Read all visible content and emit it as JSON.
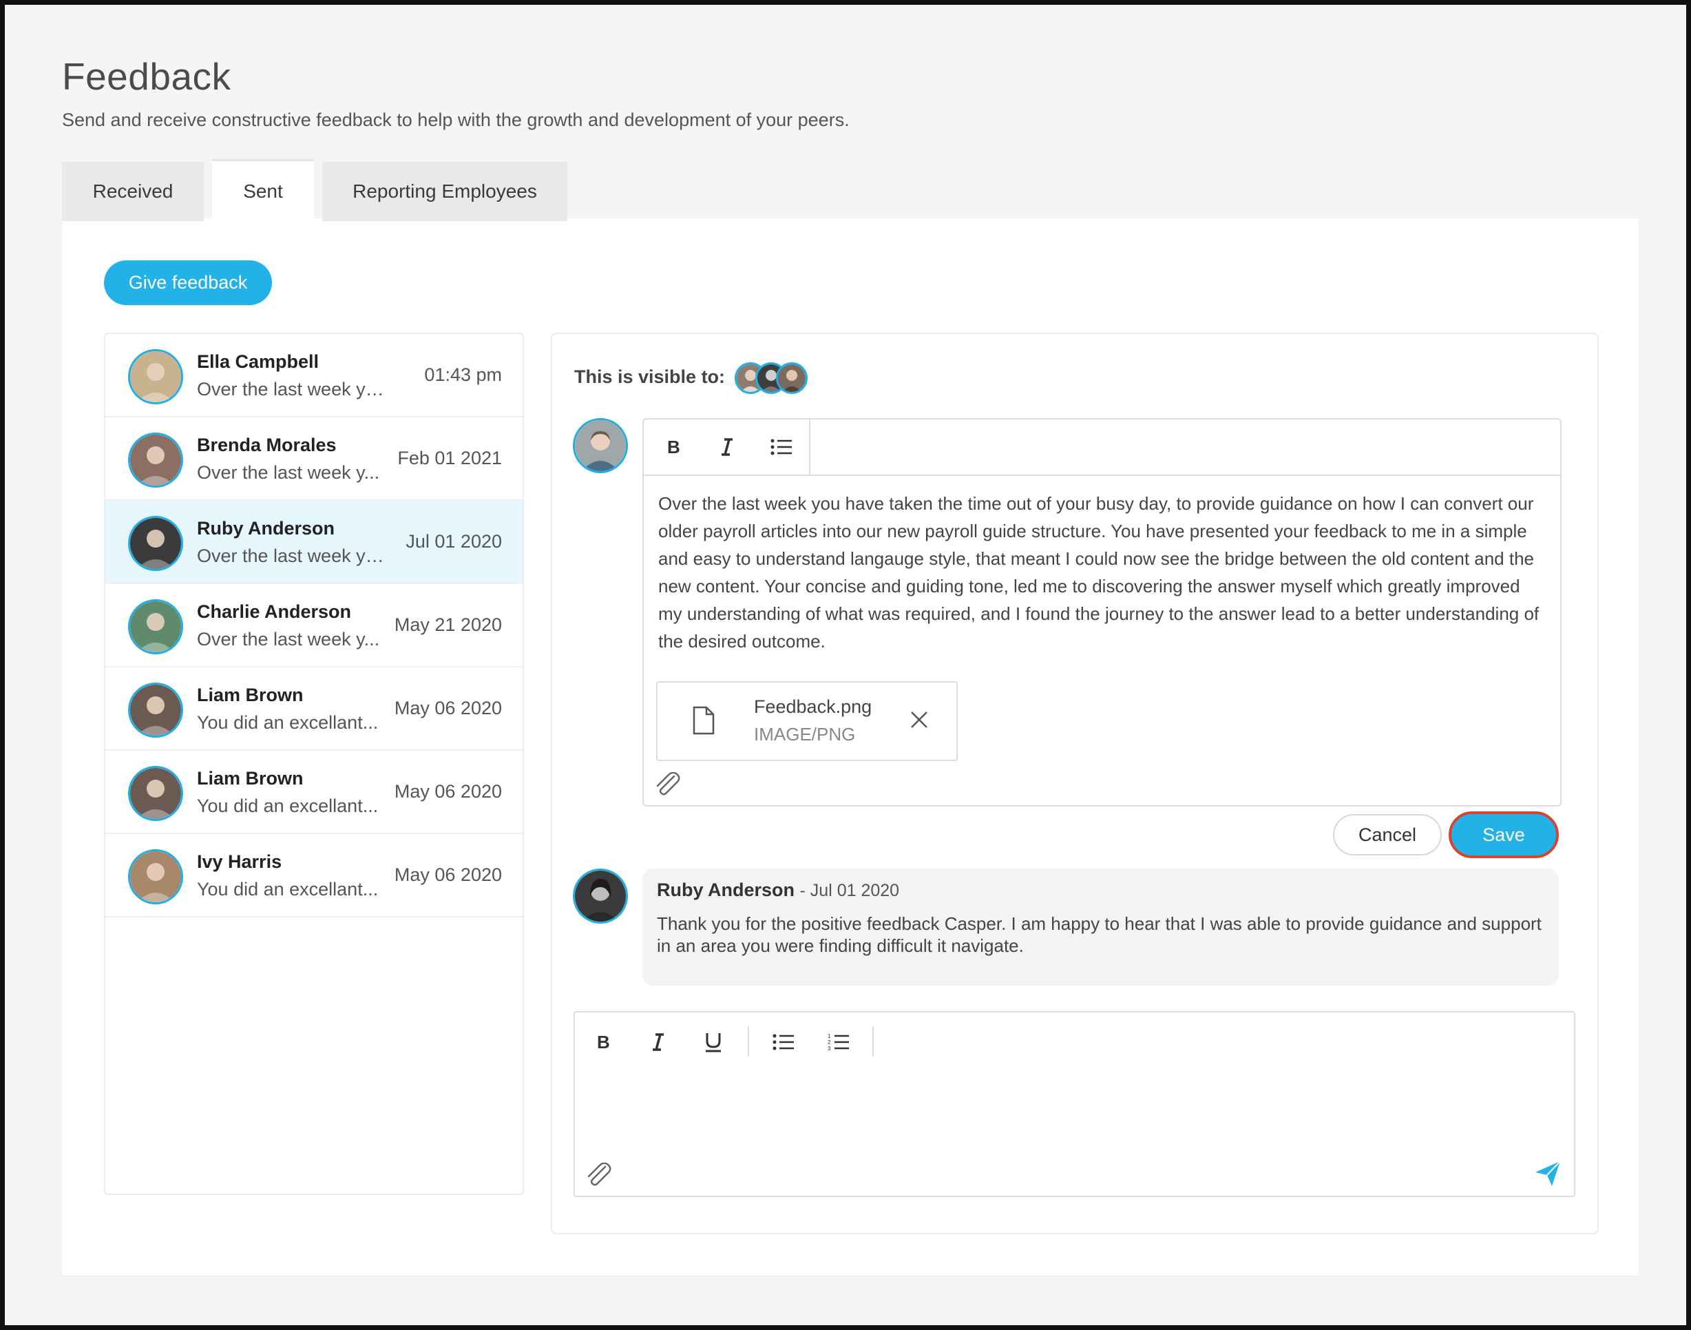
{
  "page": {
    "title": "Feedback",
    "subtitle": "Send and receive constructive feedback to help with the growth and development of your peers."
  },
  "tabs": [
    {
      "label": "Received",
      "active": false
    },
    {
      "label": "Sent",
      "active": true
    },
    {
      "label": "Reporting Employees",
      "active": false
    }
  ],
  "give_feedback_label": "Give feedback",
  "feedback_list": [
    {
      "name": "Ella Campbell",
      "preview": "Over the last week you ...",
      "date": "01:43 pm",
      "avatar_color": "#c9b28e",
      "selected": false
    },
    {
      "name": "Brenda Morales",
      "preview": "Over the last week y...",
      "date": "Feb 01 2021",
      "avatar_color": "#8a6f62",
      "selected": false
    },
    {
      "name": "Ruby Anderson",
      "preview": "Over the last week yo...",
      "date": "Jul 01 2020",
      "avatar_color": "#3b3b3b",
      "selected": true
    },
    {
      "name": "Charlie Anderson",
      "preview": "Over the last week y...",
      "date": "May 21 2020",
      "avatar_color": "#5f8a6b",
      "selected": false
    },
    {
      "name": "Liam Brown",
      "preview": "You did an excellant...",
      "date": "May 06 2020",
      "avatar_color": "#6b5a52",
      "selected": false
    },
    {
      "name": "Liam Brown",
      "preview": "You did an excellant...",
      "date": "May 06 2020",
      "avatar_color": "#6b5a52",
      "selected": false
    },
    {
      "name": "Ivy Harris",
      "preview": "You did an excellant...",
      "date": "May 06 2020",
      "avatar_color": "#a8876b",
      "selected": false
    }
  ],
  "detail": {
    "visible_label": "This is visible to:",
    "visible_avatars": [
      "#8d7b6b",
      "#3d3d3d",
      "#7a6b5e"
    ],
    "author_avatar_color": "#9fa7a8",
    "editor_toolbar": [
      "bold-icon",
      "italic-icon",
      "bullet-list-icon"
    ],
    "feedback_text": "Over the last week you have taken the time out of your busy day, to provide guidance on how I can convert our older payroll articles into our new payroll guide structure. You have presented your feedback to me in a simple and easy to understand langauge style, that meant I  could now see the bridge between the old content and the new content. Your concise and guiding tone, led me to discovering the answer myself which greatly improved my understanding of what was required, and I found the journey to the answer lead to a better understanding of the desired outcome.",
    "attachment": {
      "name": "Feedback.png",
      "type": "IMAGE/PNG"
    },
    "cancel_label": "Cancel",
    "save_label": "Save",
    "reply": {
      "author": "Ruby Anderson",
      "date": "- Jul 01 2020",
      "text": "Thank you for the positive feedback Casper. I am happy to hear that I was able to provide guidance and support in an area you were finding difficult it navigate.",
      "avatar_color": "#3b3b3b"
    },
    "composer_toolbar": [
      "bold-icon",
      "italic-icon",
      "underline-icon",
      "bullet-list-icon",
      "numbered-list-icon"
    ]
  },
  "colors": {
    "accent": "#23b2e8",
    "highlight_ring": "#d9432d",
    "selected_row": "#e6f6fd"
  }
}
